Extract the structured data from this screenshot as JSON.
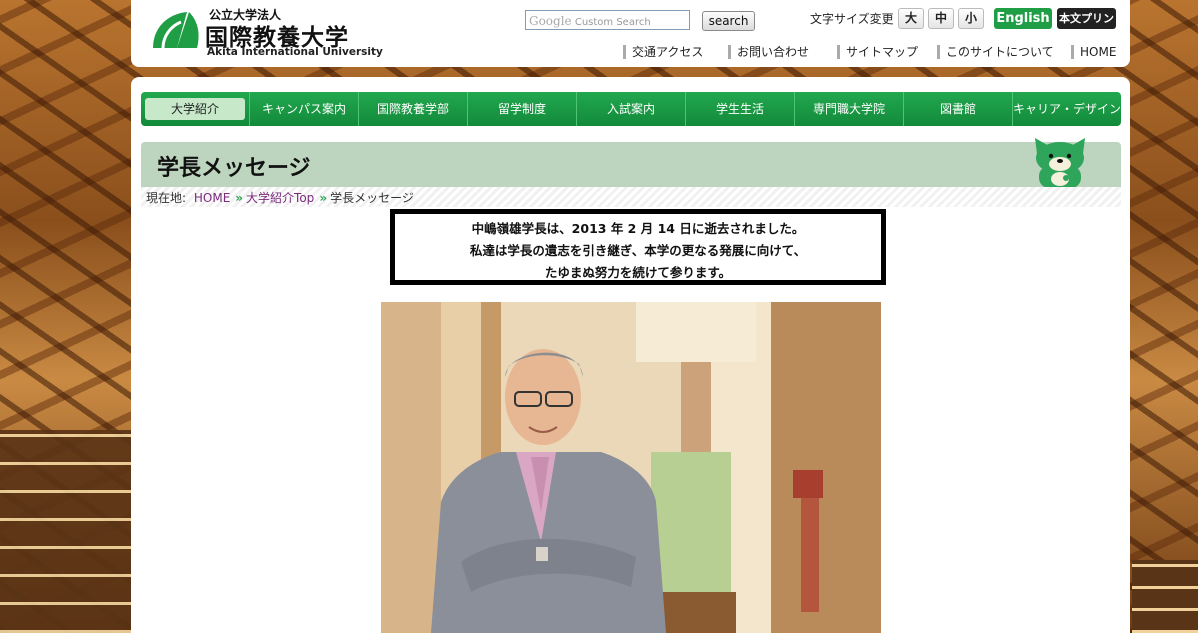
{
  "header": {
    "logo": {
      "small": "公立大学法人",
      "main": "国際教養大学",
      "english": "Akita International University"
    },
    "search": {
      "placeholder": "Custom Search",
      "brand": "Google",
      "button": "search"
    },
    "font_size": {
      "label": "文字サイズ変更",
      "large": "大",
      "medium": "中",
      "small": "小"
    },
    "english_button": "English",
    "print_button": "本文プリント",
    "util_links": [
      "交通アクセス",
      "お問い合わせ",
      "サイトマップ",
      "このサイトについて",
      "HOME"
    ],
    "colors": {
      "brand_green": "#1f9e45"
    }
  },
  "nav": {
    "items": [
      "大学紹介",
      "キャンパス案内",
      "国際教養学部",
      "留学制度",
      "入試案内",
      "学生生活",
      "専門職大学院",
      "図書館",
      "キャリア・デザイン"
    ],
    "active_index": 0
  },
  "page": {
    "title": "学長メッセージ",
    "breadcrumb": {
      "label": "現在地:",
      "items": [
        "HOME",
        "大学紹介Top",
        "学長メッセージ"
      ]
    },
    "notice": [
      "中嶋嶺雄学長は、2013 年 2 月 14 日に逝去されました。",
      "私達は学長の遺志を引き継ぎ、本学の更なる発展に向けて、",
      "たゆまぬ努力を続けて参ります。"
    ]
  }
}
